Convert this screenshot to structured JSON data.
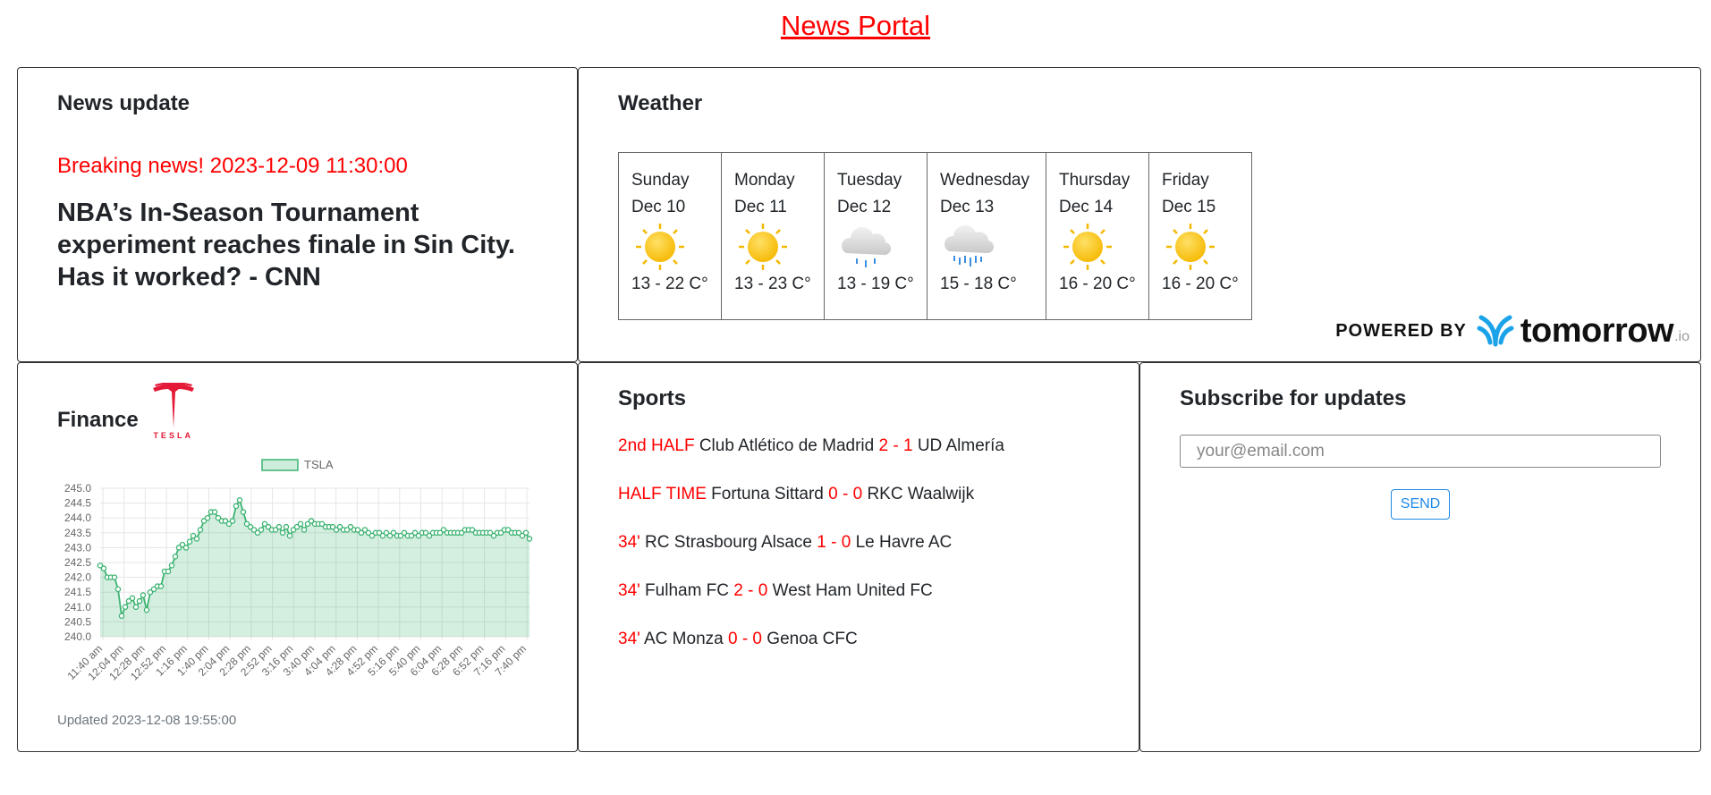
{
  "header": {
    "title": "News Portal"
  },
  "news": {
    "title": "News update",
    "breaking": "Breaking news! 2023-12-09 11:30:00",
    "headline": "NBA’s In-Season Tournament experiment reaches finale in Sin City. Has it worked? - CNN"
  },
  "weather": {
    "title": "Weather",
    "days": [
      {
        "day": "Sunday",
        "date": "Dec 10",
        "icon": "sun-icon",
        "temp": "13 - 22 C°"
      },
      {
        "day": "Monday",
        "date": "Dec 11",
        "icon": "sun-icon",
        "temp": "13 - 23 C°"
      },
      {
        "day": "Tuesday",
        "date": "Dec 12",
        "icon": "rain-cloud-icon",
        "temp": "13 - 19 C°"
      },
      {
        "day": "Wednesday",
        "date": "Dec 13",
        "icon": "heavy-rain-cloud-icon",
        "temp": "15 - 18 C°"
      },
      {
        "day": "Thursday",
        "date": "Dec 14",
        "icon": "sun-icon",
        "temp": "16 - 20 C°"
      },
      {
        "day": "Friday",
        "date": "Dec 15",
        "icon": "sun-icon",
        "temp": "16 - 20 C°"
      }
    ],
    "powered_by": "POWERED BY",
    "brand": "tomorrow",
    "brand_suffix": ".io"
  },
  "finance": {
    "title": "Finance",
    "logo_text": "TESLA",
    "updated": "Updated 2023-12-08 19:55:00"
  },
  "chart_data": {
    "type": "area",
    "series": [
      {
        "name": "TSLA",
        "color": "#3cb371"
      }
    ],
    "ylim": [
      240.0,
      245.0
    ],
    "y_ticks": [
      "240.0",
      "240.5",
      "241.0",
      "241.5",
      "242.0",
      "242.5",
      "243.0",
      "243.5",
      "244.0",
      "244.5",
      "245.0"
    ],
    "x_tick_labels": [
      "11:40 am",
      "12:04 pm",
      "12:28 pm",
      "12:52 pm",
      "1:16 pm",
      "1:40 pm",
      "2:04 pm",
      "2:28 pm",
      "2:52 pm",
      "3:16 pm",
      "3:40 pm",
      "4:04 pm",
      "4:28 pm",
      "4:52 pm",
      "5:16 pm",
      "5:40 pm",
      "6:04 pm",
      "6:28 pm",
      "6:52 pm",
      "7:16 pm",
      "7:40 pm"
    ],
    "values": [
      242.4,
      242.3,
      242.0,
      242.0,
      242.0,
      241.6,
      240.7,
      241.0,
      241.2,
      241.3,
      241.0,
      241.2,
      241.4,
      240.9,
      241.5,
      241.6,
      241.7,
      241.7,
      242.2,
      242.2,
      242.4,
      242.7,
      243.0,
      243.1,
      243.0,
      243.2,
      243.4,
      243.3,
      243.6,
      243.9,
      244.0,
      244.2,
      244.2,
      244.0,
      243.9,
      243.9,
      243.8,
      243.9,
      244.4,
      244.6,
      244.2,
      243.8,
      243.7,
      243.6,
      243.5,
      243.6,
      243.8,
      243.7,
      243.6,
      243.6,
      243.7,
      243.5,
      243.7,
      243.4,
      243.6,
      243.7,
      243.8,
      243.6,
      243.8,
      243.9,
      243.8,
      243.8,
      243.8,
      243.7,
      243.7,
      243.7,
      243.6,
      243.7,
      243.6,
      243.6,
      243.7,
      243.6,
      243.6,
      243.5,
      243.6,
      243.5,
      243.4,
      243.5,
      243.5,
      243.4,
      243.5,
      243.4,
      243.5,
      243.4,
      243.4,
      243.5,
      243.4,
      243.4,
      243.5,
      243.4,
      243.5,
      243.5,
      243.4,
      243.5,
      243.5,
      243.5,
      243.6,
      243.5,
      243.5,
      243.5,
      243.5,
      243.5,
      243.6,
      243.6,
      243.6,
      243.5,
      243.5,
      243.5,
      243.5,
      243.5,
      243.4,
      243.5,
      243.5,
      243.6,
      243.6,
      243.5,
      243.5,
      243.5,
      243.4,
      243.5,
      243.3
    ],
    "grid": true,
    "legend": "top-center"
  },
  "sports": {
    "title": "Sports",
    "matches": [
      {
        "status": "2nd HALF",
        "home": "Club Atlético de Madrid",
        "score": "2 - 1",
        "away": "UD Almería"
      },
      {
        "status": "HALF TIME",
        "home": "Fortuna Sittard",
        "score": "0 - 0",
        "away": "RKC Waalwijk"
      },
      {
        "status": "34'",
        "home": "RC Strasbourg Alsace",
        "score": "1 - 0",
        "away": "Le Havre AC"
      },
      {
        "status": "34'",
        "home": "Fulham FC",
        "score": "2 - 0",
        "away": "West Ham United FC"
      },
      {
        "status": "34'",
        "home": "AC Monza",
        "score": "0 - 0",
        "away": "Genoa CFC"
      }
    ]
  },
  "subscribe": {
    "title": "Subscribe for updates",
    "placeholder": "your@email.com",
    "value": "",
    "button_label": "SEND"
  }
}
